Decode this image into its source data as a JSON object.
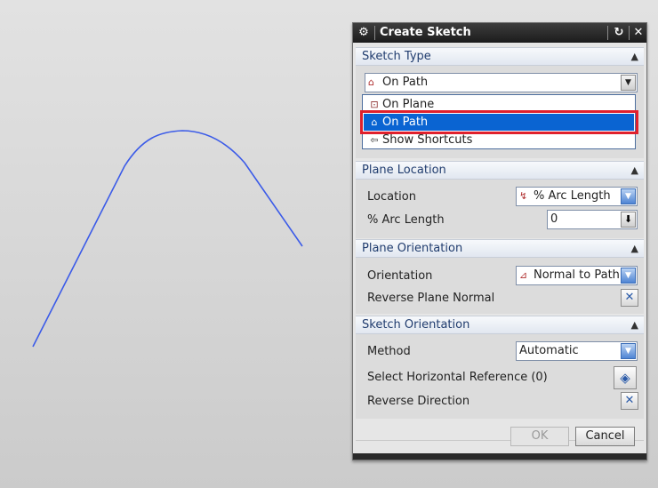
{
  "dialog": {
    "title": "Create Sketch",
    "icons": {
      "title": "gear-icon",
      "reset": "reset-icon",
      "close": "close-icon"
    }
  },
  "sketch_type": {
    "header": "Sketch Type",
    "selected": "On Path",
    "dropdown_items": [
      {
        "label": "On Plane",
        "icon": "on-plane-icon",
        "selected": false
      },
      {
        "label": "On Path",
        "icon": "on-path-icon",
        "selected": true
      },
      {
        "label": "Show Shortcuts",
        "icon": "shortcuts-icon",
        "selected": false
      }
    ]
  },
  "plane_location": {
    "header": "Plane Location",
    "location_label": "Location",
    "location_value": "% Arc Length",
    "arc_label": "% Arc Length",
    "arc_value": "0"
  },
  "plane_orientation": {
    "header": "Plane Orientation",
    "orientation_label": "Orientation",
    "orientation_value": "Normal to Path",
    "reverse_label": "Reverse Plane Normal"
  },
  "sketch_orientation": {
    "header": "Sketch Orientation",
    "method_label": "Method",
    "method_value": "Automatic",
    "horiz_ref_label": "Select Horizontal Reference (0)",
    "reverse_dir_label": "Reverse Direction"
  },
  "buttons": {
    "ok": "OK",
    "cancel": "Cancel"
  },
  "colors": {
    "curve": "#3b5be8",
    "selection": "#0a64d2",
    "highlight": "#e0202c"
  }
}
